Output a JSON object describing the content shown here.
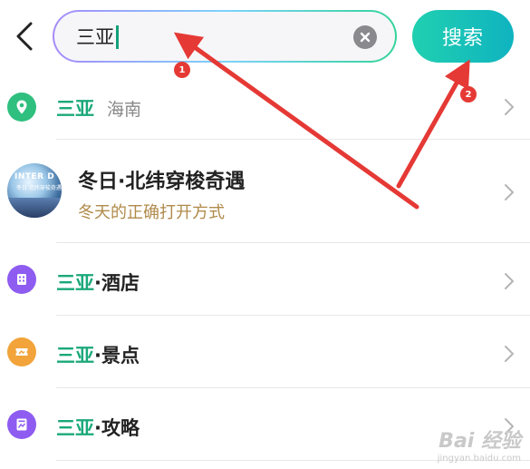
{
  "header": {
    "back_icon": "chevron-left-icon",
    "search_value": "三亚",
    "clear_icon": "clear-x-icon",
    "search_button_label": "搜索"
  },
  "results": {
    "place": {
      "highlight": "三亚",
      "region": "海南",
      "icon": "location-pin-icon",
      "icon_color": "#2fbf7f"
    },
    "promo": {
      "title": "冬日·北纬穿梭奇遇",
      "subtitle": "冬天的正确打开方式",
      "thumb_line1": "INTER D",
      "thumb_line2": "冬日·北纬穿梭奇遇"
    },
    "hotel": {
      "highlight": "三亚",
      "rest": "·酒店",
      "icon": "hotel-building-icon",
      "icon_color": "#8e5cf0"
    },
    "scenic": {
      "highlight": "三亚",
      "rest": "·景点",
      "icon": "ticket-icon",
      "icon_color": "#f2a33a"
    },
    "guide": {
      "highlight": "三亚",
      "rest": "·攻略",
      "icon": "guide-book-icon",
      "icon_color": "#8e5cf0"
    }
  },
  "annotations": {
    "badge1": "1",
    "badge2": "2",
    "arrow_color": "#e53935"
  },
  "watermark": {
    "line1": "Bai 经验",
    "line2": "jingyan.baidu.com"
  }
}
